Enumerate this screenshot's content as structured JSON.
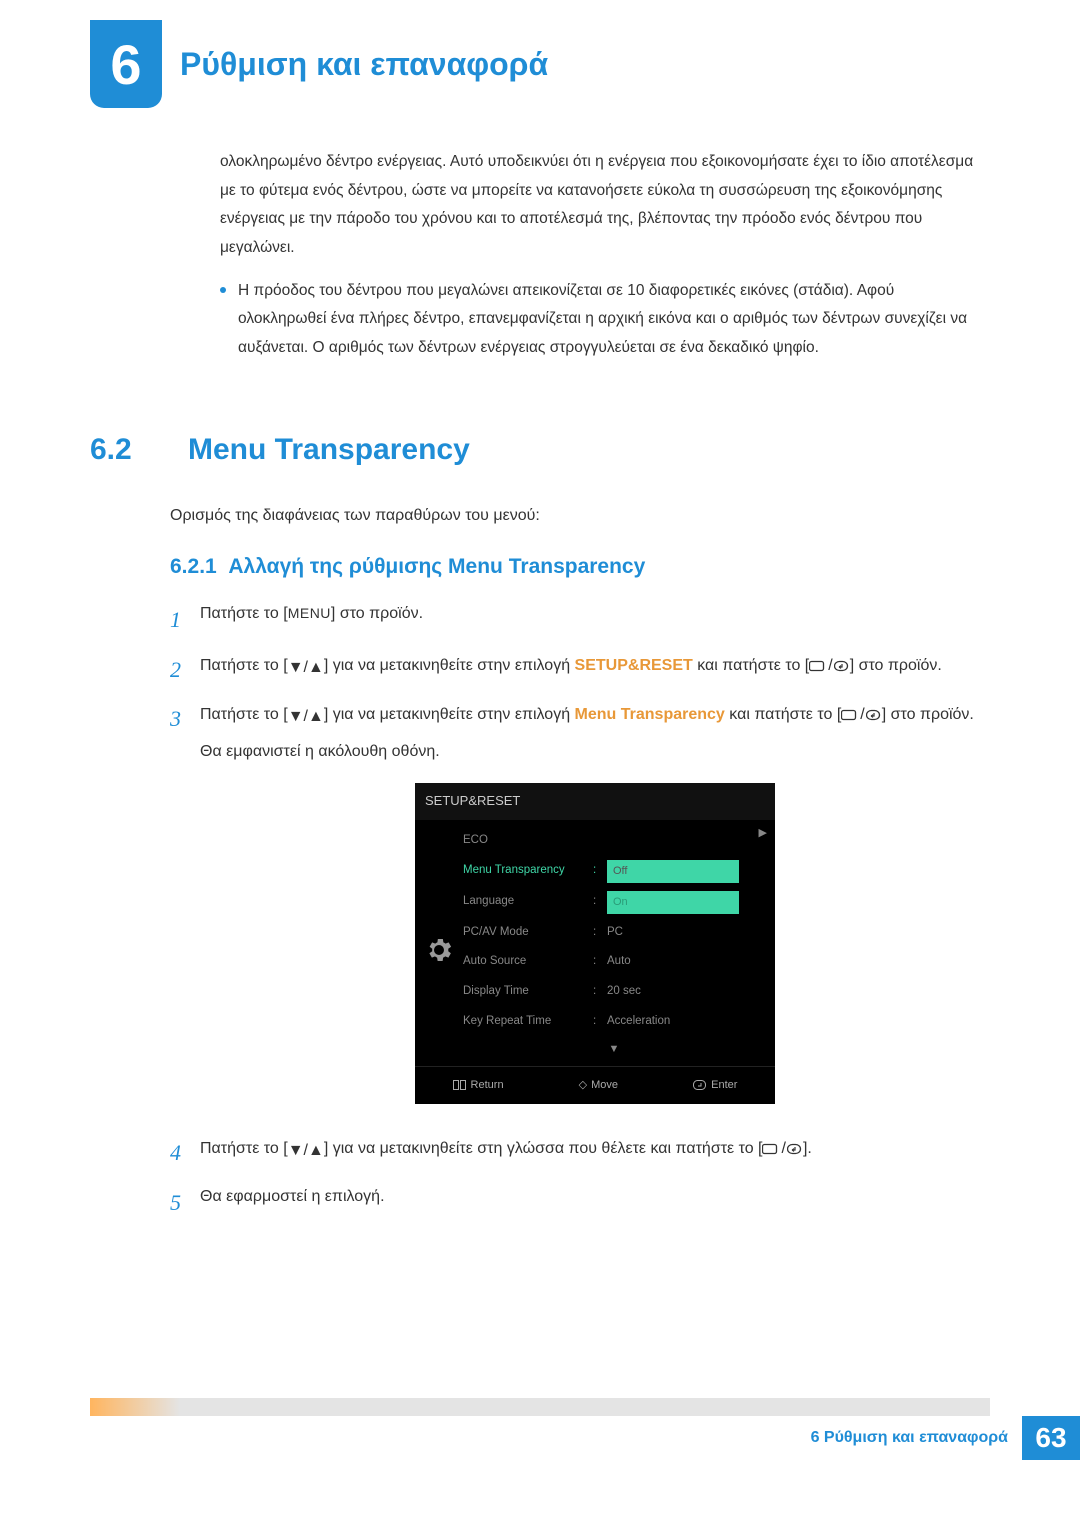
{
  "header": {
    "chapter": "6",
    "title": "Ρύθμιση και επαναφορά"
  },
  "intro": {
    "p1": "ολοκληρωμένο δέντρο ενέργειας. Αυτό υποδεικνύει ότι η ενέργεια που εξοικονομήσατε έχει το ίδιο αποτέλεσμα με το φύτεμα ενός δέντρου, ώστε να μπορείτε να κατανοήσετε εύκολα τη συσσώρευση της εξοικονόμησης ενέργειας με την πάροδο του χρόνου και το αποτέλεσμά της, βλέποντας την πρόοδο ενός δέντρου που μεγαλώνει.",
    "b1": "Η πρόοδος του δέντρου που μεγαλώνει απεικονίζεται σε 10 διαφορετικές εικόνες (στάδια). Αφού ολοκληρωθεί ένα πλήρες δέντρο, επανεμφανίζεται η αρχική εικόνα και ο αριθμός των δέντρων συνεχίζει να αυξάνεται. Ο αριθμός των δέντρων ενέργειας στρογγυλεύεται σε ένα δεκαδικό ψηφίο."
  },
  "section": {
    "num": "6.2",
    "title": "Menu Transparency",
    "desc": "Ορισμός της διαφάνειας των παραθύρων του μενού:"
  },
  "subsection": {
    "num": "6.2.1",
    "title": "Αλλαγή της ρύθμισης Menu Transparency"
  },
  "steps": {
    "s1_a": "Πατήστε το [",
    "s1_menu": "MENU",
    "s1_b": "] στο προϊόν.",
    "s2_a": "Πατήστε το [",
    "s2_b": "] για να μετακινηθείτε στην επιλογή ",
    "s2_bold": "SETUP&RESET",
    "s2_c": " και πατήστε το [",
    "s2_d": "] στο προϊόν.",
    "s3_a": "Πατήστε το [",
    "s3_b": "] για να μετακινηθείτε στην επιλογή ",
    "s3_bold": "Menu Transparency",
    "s3_c": " και πατήστε το [",
    "s3_d": "] στο προϊόν.",
    "s3_e": "Θα εμφανιστεί η ακόλουθη οθόνη.",
    "s4_a": "Πατήστε το [",
    "s4_b": "] για να μετακινηθείτε στη γλώσσα που θέλετε και πατήστε το [",
    "s4_c": "].",
    "s5": "Θα εφαρμοστεί η επιλογή."
  },
  "osd": {
    "title": "SETUP&RESET",
    "rows": {
      "eco": "ECO",
      "mt": "Menu Transparency",
      "lang": "Language",
      "pcav": "PC/AV Mode",
      "auto": "Auto Source",
      "disp": "Display Time",
      "key": "Key Repeat Time"
    },
    "vals": {
      "off": "Off",
      "on": "On",
      "pc": "PC",
      "auto": "Auto",
      "sec": "20 sec",
      "accel": "Acceleration"
    },
    "footer": {
      "ret": "Return",
      "move": "Move",
      "enter": "Enter"
    }
  },
  "footer": {
    "label": "6 Ρύθμιση και επαναφορά",
    "page": "63"
  }
}
